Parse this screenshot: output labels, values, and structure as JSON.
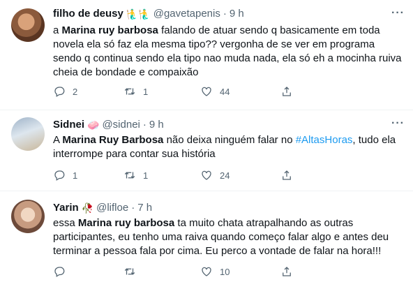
{
  "tweets": [
    {
      "name": "filho de deusy",
      "emoji": "🧜‍♂️🧜‍♂️",
      "handle": "@gavetapenis",
      "time": "9 h",
      "text_parts": [
        "a ",
        "Marina ruy barbosa",
        " falando de atuar sendo q basicamente em toda novela ela só faz ela mesma tipo?? vergonha de se ver em programa sendo q continua sendo ela tipo nao muda nada, ela só eh a mocinha ruiva cheia de bondade e compaixão"
      ],
      "replies": "2",
      "retweets": "1",
      "likes": "44"
    },
    {
      "name": "Sidnei",
      "emoji": "🧼",
      "handle": "@sidnei",
      "time": "9 h",
      "text_parts": [
        "A ",
        "Marina Ruy Barbosa",
        " não deixa ninguém falar no ",
        "#AltasHoras",
        ", tudo ela interrompe para contar sua história"
      ],
      "replies": "1",
      "retweets": "1",
      "likes": "24"
    },
    {
      "name": "Yarin",
      "emoji": "🥀",
      "handle": "@lifloe",
      "time": "7 h",
      "text_parts": [
        "essa ",
        "Marina ruy barbosa",
        " ta muito chata atrapalhando as outras participantes, eu tenho uma raiva quando começo falar algo e antes deu terminar a pessoa fala por cima. Eu perco a vontade de falar na hora!!!"
      ],
      "replies": "",
      "retweets": "",
      "likes": "10"
    }
  ],
  "ui": {
    "dot": "·",
    "more": "···"
  },
  "colors": {
    "link": "#1d9bf0",
    "muted": "#536471",
    "divider": "#eff3f4"
  },
  "icons": [
    "reply-icon",
    "retweet-icon",
    "like-icon",
    "share-icon",
    "more-icon"
  ]
}
